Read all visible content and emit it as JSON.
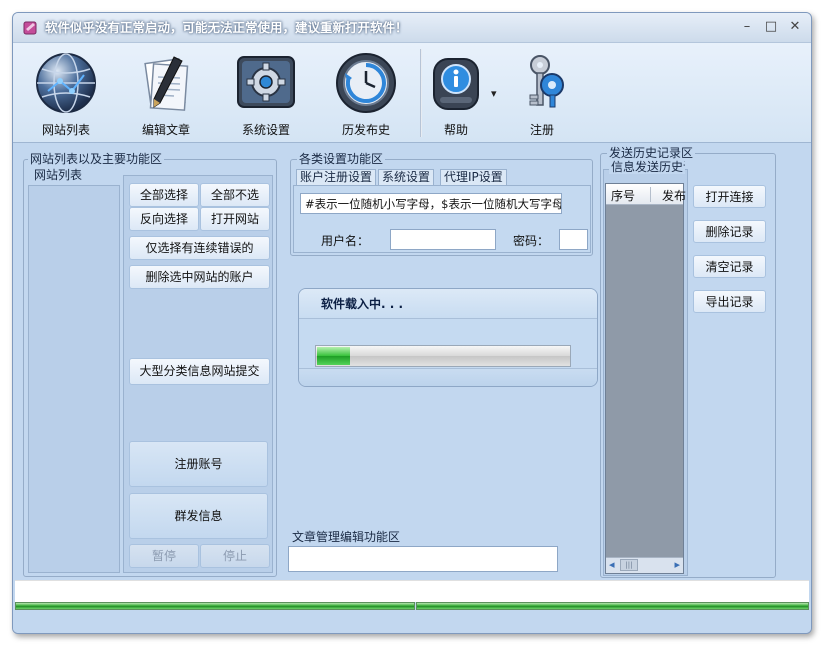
{
  "window": {
    "title": "软件似乎没有正常启动，可能无法正常使用，建议重新打开软件！",
    "controls": {
      "minimize": "–",
      "maximize": "□",
      "close": "✕"
    }
  },
  "toolbar": {
    "items": [
      {
        "label": "网站列表",
        "icon": "globe-icon"
      },
      {
        "label": "编辑文章",
        "icon": "pen-document-icon"
      },
      {
        "label": "系统设置",
        "icon": "gear-icon"
      },
      {
        "label": "历发布史",
        "icon": "clock-history-icon"
      },
      {
        "label": "帮助",
        "icon": "info-icon",
        "dropdown": "▾"
      },
      {
        "label": "注册",
        "icon": "keys-icon"
      }
    ]
  },
  "left_panel": {
    "group_title": "网站列表以及主要功能区",
    "list_title": "网站列表",
    "buttons": {
      "select_all": "全部选择",
      "deselect_all": "全部不选",
      "invert": "反向选择",
      "open_site": "打开网站",
      "select_errors": "仅选择有连续错误的",
      "delete_accounts": "删除选中网站的账户",
      "big_sites": "大型分类信息网站提交",
      "register": "注册账号",
      "broadcast": "群发信息",
      "pause": "暂停",
      "stop": "停止"
    }
  },
  "settings_panel": {
    "group_title": "各类设置功能区",
    "tabs": [
      "账户注册设置",
      "系统设置",
      "代理IP设置"
    ],
    "hint": "#表示一位随机小写字母，$表示一位随机大写字母",
    "username_label": "用户名：",
    "username_value": "",
    "password_label": "密码：",
    "password_value": ""
  },
  "loader": {
    "text": "软件载入中. . .",
    "progress": 0.13
  },
  "article_panel": {
    "group_title": "文章管理编辑功能区"
  },
  "history_panel": {
    "group_title": "发送历史记录区",
    "sub_title": "信息发送历史记录/历理",
    "columns": [
      "序号",
      "发布"
    ],
    "scroll_left": "◂",
    "scroll_mid": "|||",
    "scroll_right": "▸",
    "buttons": {
      "open_link": "打开连接",
      "delete_record": "删除记录",
      "clear_records": "清空记录",
      "export_records": "导出记录"
    }
  },
  "colors": {
    "window_bg": "#c2d7ef",
    "progress_green": "#2fa82f",
    "border": "#95acc8"
  }
}
